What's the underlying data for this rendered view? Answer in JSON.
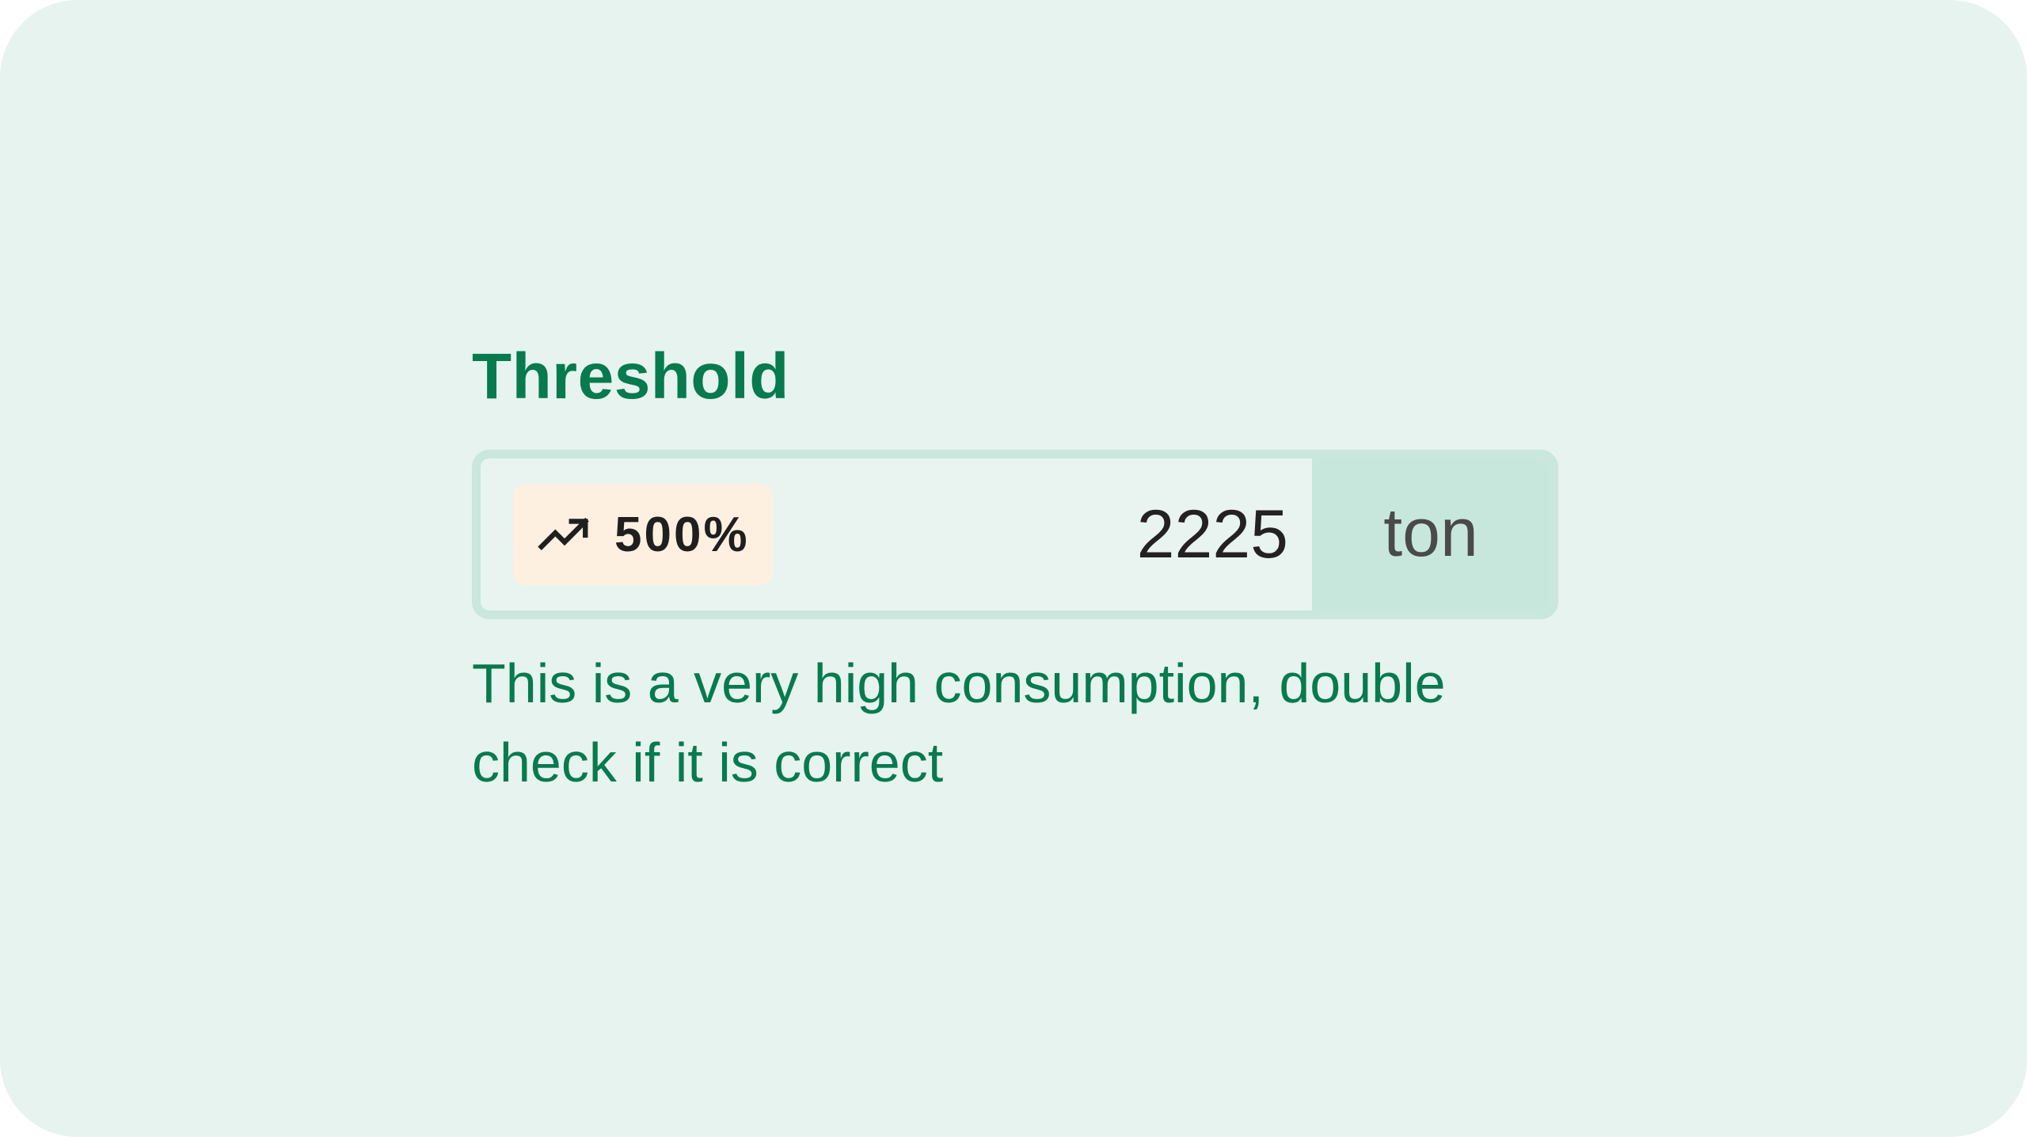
{
  "field": {
    "label": "Threshold",
    "trend_badge": {
      "icon": "trending-up-icon",
      "text": "500%"
    },
    "value": "2225",
    "unit": "ton",
    "helper_text": "This is a very high consumption, double check if it is correct"
  },
  "colors": {
    "background": "#e7f3ef",
    "accent": "#077a4f",
    "border": "#c9e7dc",
    "unit_bg": "#c8e7dc",
    "badge_bg": "#fdf0e1"
  }
}
